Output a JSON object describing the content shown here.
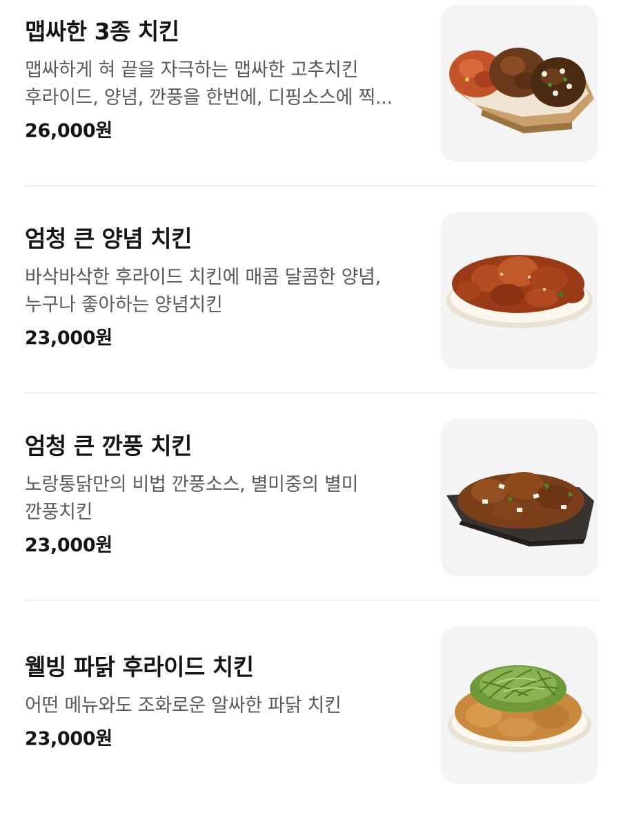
{
  "menu": {
    "items": [
      {
        "name": "맵싸한 3종 치킨",
        "description": "맵싸하게 혀 끝을 자극하는 맵싸한 고추치킨 후라이드, 양념, 깐풍을 한번에, 디핑소스에 찍...",
        "price": "26,000원",
        "image_icon": "three-chicken-platter-image"
      },
      {
        "name": "엄청 큰 양념 치킨",
        "description": "바삭바삭한 후라이드 치킨에 매콤 달콤한 양념, 누구나 좋아하는 양념치킨",
        "price": "23,000원",
        "image_icon": "seasoned-chicken-image"
      },
      {
        "name": "엄청 큰 깐풍 치킨",
        "description": "노랑통닭만의 비법 깐풍소스, 별미중의 별미 깐풍치킨",
        "price": "23,000원",
        "image_icon": "kkanpung-chicken-image"
      },
      {
        "name": "웰빙 파닭 후라이드 치킨",
        "description": "어떤 메뉴와도 조화로운 알싸한 파닭 치킨",
        "price": "23,000원",
        "image_icon": "green-onion-chicken-image"
      }
    ]
  },
  "colors": {
    "title": "#141414",
    "description": "#5a5a5a",
    "thumb_background": "#f4f4f4",
    "divider": "#f0f0f0"
  }
}
